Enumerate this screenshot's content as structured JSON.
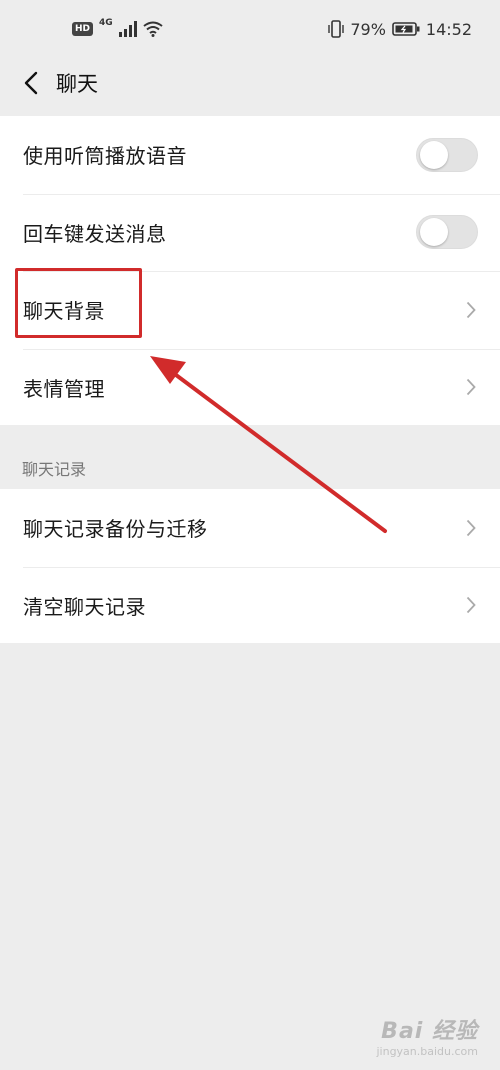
{
  "status_bar": {
    "hd": "HD",
    "network": "4G",
    "battery": "79%",
    "time": "14:52"
  },
  "header": {
    "title": "聊天"
  },
  "settings": [
    {
      "label": "使用听筒播放语音",
      "control": "toggle",
      "on": false
    },
    {
      "label": "回车键发送消息",
      "control": "toggle",
      "on": false
    },
    {
      "label": "聊天背景",
      "control": "chevron"
    },
    {
      "label": "表情管理",
      "control": "chevron"
    }
  ],
  "chat_records": {
    "section_title": "聊天记录",
    "items": [
      {
        "label": "聊天记录备份与迁移"
      },
      {
        "label": "清空聊天记录"
      }
    ]
  },
  "annotation": {
    "color": "#d12b2b",
    "highlighted_item": "聊天背景"
  },
  "watermark": {
    "logo": "Bai 经验",
    "url": "jingyan.baidu.com"
  }
}
